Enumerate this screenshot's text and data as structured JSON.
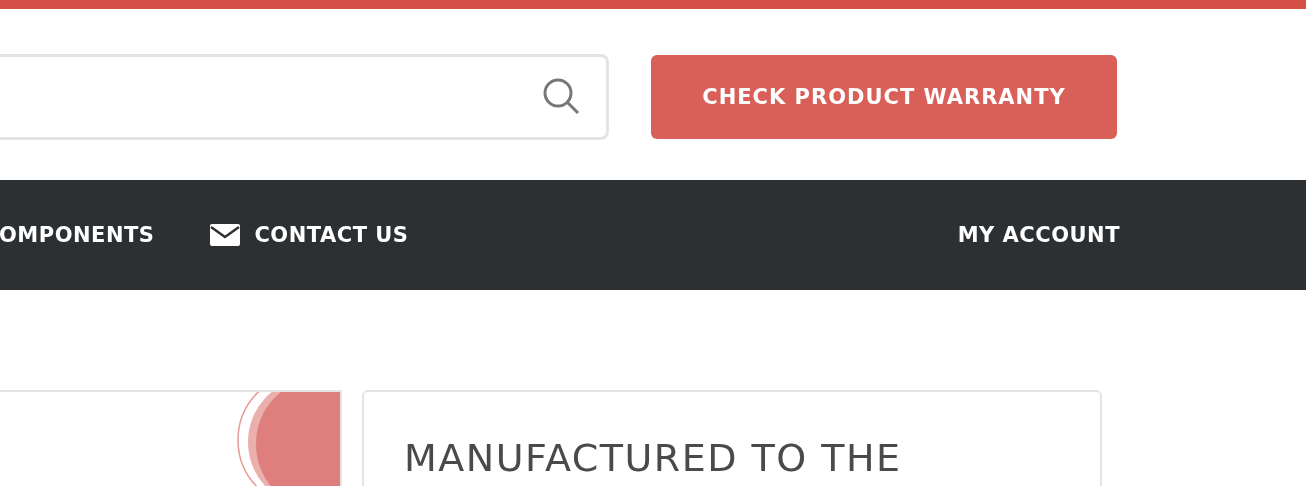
{
  "header": {
    "warranty_button": {
      "label": "CHECK PRODUCT WARRANTY"
    }
  },
  "nav": {
    "items": [
      {
        "label": "OMPONENTS",
        "kind": "plain"
      },
      {
        "label": "CONTACT US",
        "kind": "iconed"
      }
    ],
    "account": {
      "label": "MY ACCOUNT"
    }
  },
  "content": {
    "feature_card": {
      "title": "MANUFACTURED TO THE"
    }
  }
}
